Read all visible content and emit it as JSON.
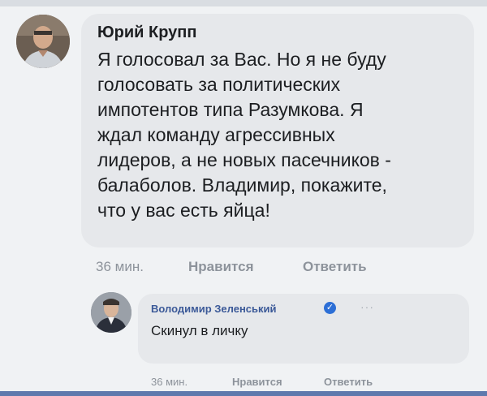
{
  "main_comment": {
    "author": "Юрий Крупп",
    "lines": [
      "Я голосовал за Вас. Но я не буду",
      "голосовать за политических",
      "импотентов типа Разумкова. Я",
      "ждал команду агрессивных",
      "лидеров, а не новых пасечников -",
      "балаболов. Владимир, покажите,",
      "что у вас есть яйца!"
    ],
    "time": "36 мин.",
    "like_label": "Нравится",
    "reply_label": "Ответить"
  },
  "reply_comment": {
    "author": "Володимир Зеленський",
    "verified_icon": "check-badge-icon",
    "more_icon": "more-dots-icon",
    "more_text": "···",
    "text": "Скинул в личку",
    "time": "36 мин.",
    "like_label": "Нравится",
    "reply_label": "Ответить"
  },
  "colors": {
    "bubble": "#e6e8eb",
    "page_bg": "#f0f2f4",
    "verified": "#2d6fd6",
    "action_text": "#8d939b"
  }
}
